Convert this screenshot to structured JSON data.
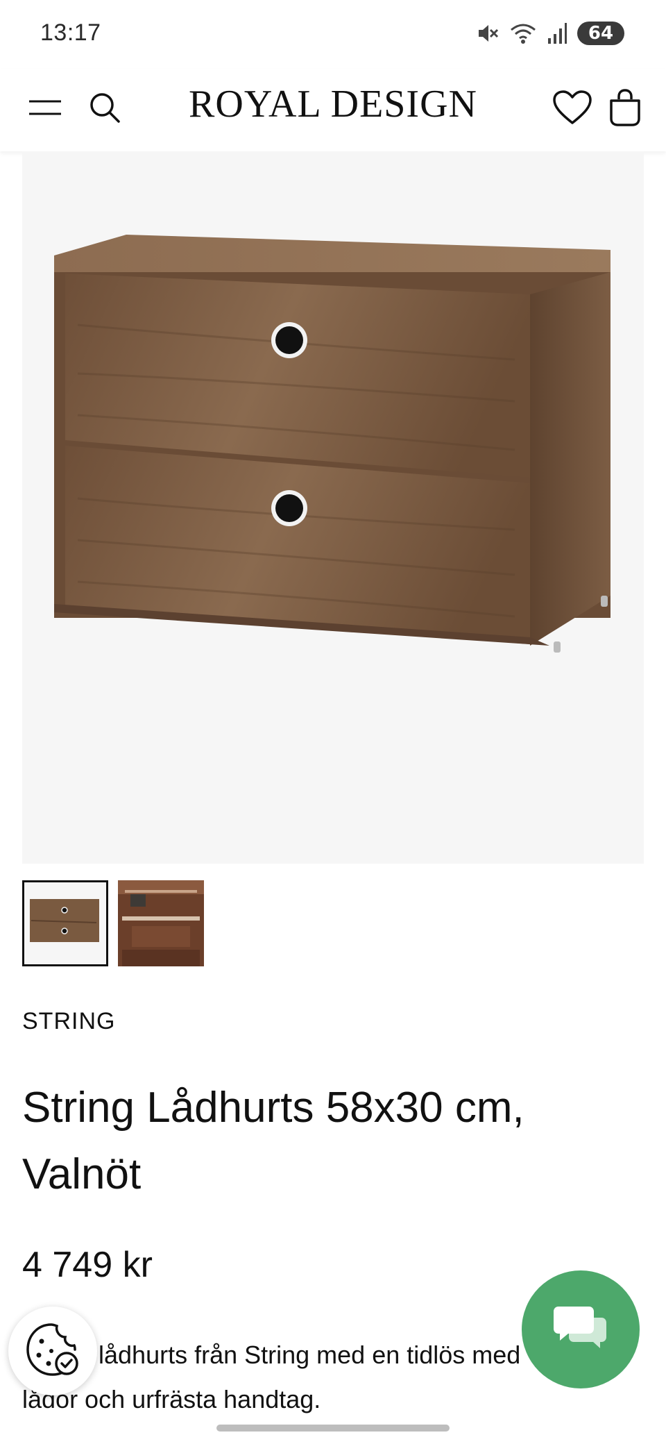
{
  "status_bar": {
    "time": "13:17",
    "battery": "64",
    "icons": [
      "mute-icon",
      "wifi-icon",
      "signal-icon"
    ]
  },
  "header": {
    "brand": "ROYAL DESIGN",
    "icons": [
      "menu-icon",
      "search-icon",
      "heart-icon",
      "bag-icon"
    ]
  },
  "gallery": {
    "thumbnails": [
      "thumbnail-drawer-unit",
      "thumbnail-interior"
    ],
    "selected_index": 0
  },
  "product": {
    "brand": "STRING",
    "title": "String Lådhurts 58x30 cm, Valnöt",
    "price": "4 749 kr",
    "description": "lådhurts från String med en tidlös med lådor och urfrästa handtag."
  },
  "floating": {
    "cookie_icon": "cookie-icon",
    "chat_icon": "chat-icon"
  },
  "colors": {
    "chat_button": "#4da86b",
    "image_background": "#f6f6f6",
    "wood": "#7a5a40"
  }
}
